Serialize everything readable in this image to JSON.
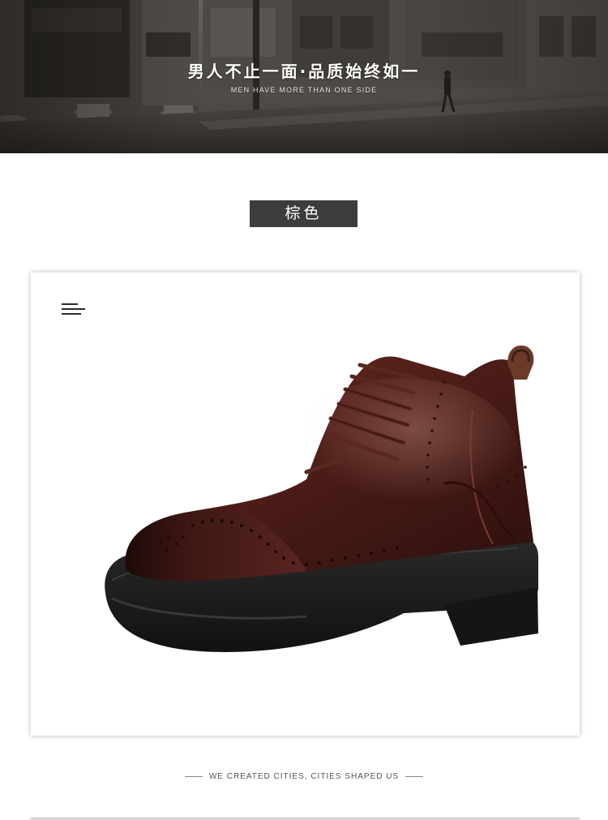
{
  "hero": {
    "title": "男人不止一面·品质始终如一",
    "subtitle": "MEN HAVE MORE THAN ONE SIDE"
  },
  "color_tag": {
    "label": "棕色"
  },
  "product": {
    "image": "brown-brogue-lace-up-boot",
    "menu_icon": "menu-icon"
  },
  "footer": {
    "tagline": "WE CREATED CITIES, CITIES SHAPED US"
  },
  "colors": {
    "tag_background": "#3c3c3c",
    "boot_leather": "#4a1c17",
    "sole": "#1e1e1e"
  }
}
